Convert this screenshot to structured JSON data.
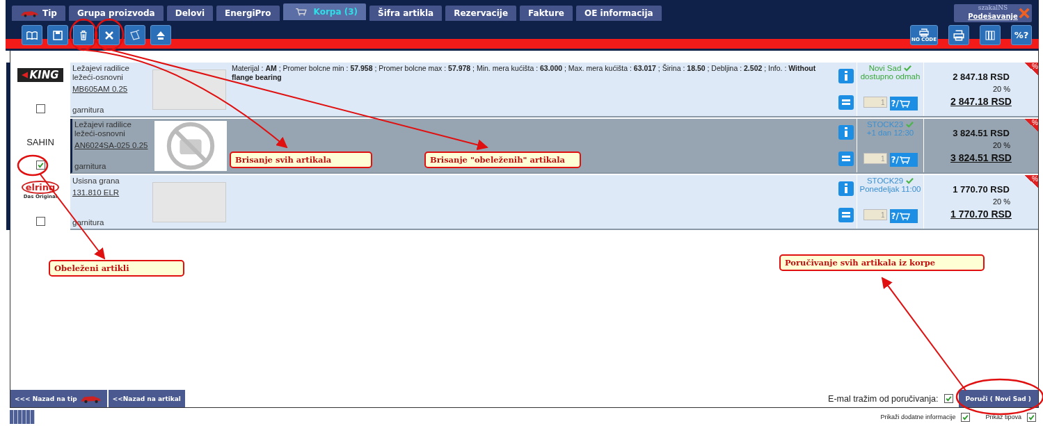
{
  "tabs": [
    {
      "label": "Tip",
      "selected": false
    },
    {
      "label": "Grupa proizvoda",
      "selected": false
    },
    {
      "label": "Delovi",
      "selected": false
    },
    {
      "label": "EnergiPro",
      "selected": false
    },
    {
      "label": "Korpa (3)",
      "selected": true
    },
    {
      "label": "Šifra artikla",
      "selected": false
    },
    {
      "label": "Rezervacije",
      "selected": false
    },
    {
      "label": "Fakture",
      "selected": false
    },
    {
      "label": "OE informacija",
      "selected": false
    }
  ],
  "user": {
    "name": "szakalNS",
    "settings": "Podešavanje"
  },
  "toolbar_right": {
    "no_code": "NO CODE",
    "percent_help": "%?"
  },
  "rows": [
    {
      "brand": {
        "kind": "king",
        "text": "KING"
      },
      "name": "Ležajevi radilice ležeći-osnovni",
      "code": "MB605AM 0.25",
      "unit": "garnitura",
      "kind": "photo",
      "checked": false,
      "selected": false,
      "description": "Materijal : **AM** ; Promer bolcne min : **57.958** ; Promer bolcne max : **57.978** ; Min. mera kućišta : **63.000** ; Max. mera kućišta : **63.017** ; Širina : **18.50** ; Debljina : **2.502** ; Info. : **Without flange bearing**",
      "stock": "Novi Sad",
      "availability": "dostupno odmah",
      "color": "#3aa63a",
      "quantity": "1",
      "cart": "?/",
      "price": "2 847.18 RSD",
      "discount": "20 %",
      "net_price": "2 847.18 RSD",
      "badge": "%"
    },
    {
      "brand": {
        "kind": "text",
        "text": "SAHIN"
      },
      "name": "Ležajevi radilice ležeći-osnovni",
      "code": "AN6024SA-025 0.25",
      "unit": "garnitura",
      "kind": "no_photo",
      "checked": true,
      "selected": true,
      "stock": "STOCK23",
      "availability": "+1 dan 12:30",
      "color": "#3b8fd0",
      "quantity": "1",
      "cart": "?/",
      "price": "3 824.51 RSD",
      "discount": "20 %",
      "net_price": "3 824.51 RSD",
      "badge": "%"
    },
    {
      "brand": {
        "kind": "elring",
        "text": "elring",
        "subtext": "Das Original"
      },
      "name": "Usisna grana",
      "code": "131.810  ELR",
      "unit": "garnitura",
      "kind": "photo",
      "checked": false,
      "selected": false,
      "stock": "STOCK29",
      "availability": "Ponedeljak 11:00",
      "color": "#3b8fd0",
      "quantity": "1",
      "cart": "?/",
      "price": "1 770.70 RSD",
      "discount": "20 %",
      "net_price": "1 770.70 RSD",
      "badge": "%"
    }
  ],
  "annotations": [
    "Brisanje svih artikala",
    "Brisanje \"obeleženih\" artikala",
    "Obeleženi artikli",
    "Poručivanje svih artikala iz korpe"
  ],
  "bottom": {
    "back_type": "<<< Nazad na tip",
    "back_article": "<<Nazad na artikal",
    "email_label": "E-mal tražim od poručivanja:",
    "email_checked": true,
    "order_button": "Poruči ( Novi Sad )"
  },
  "footer": [
    {
      "label": "Prikaži dodatne informacije",
      "checked": true
    },
    {
      "label": "Prikaz tipova",
      "checked": true
    }
  ]
}
